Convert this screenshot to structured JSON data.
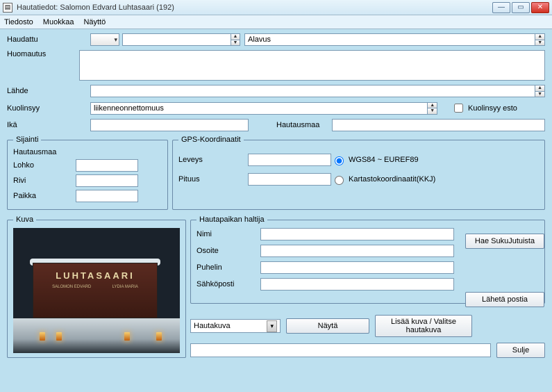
{
  "window": {
    "title": "Hautatiedot: Salomon Edvard Luhtasaari (192)"
  },
  "menu": {
    "file": "Tiedosto",
    "edit": "Muokkaa",
    "view": "Näyttö"
  },
  "fields": {
    "haudattu_label": "Haudattu",
    "haudattu_combo": "",
    "haudattu_spin": "",
    "haudattu_big": "Alavus",
    "huomautus_label": "Huomautus",
    "huomautus_value": "",
    "lahde_label": "Lähde",
    "lahde_value": "",
    "kuolinsyy_label": "Kuolinsyy",
    "kuolinsyy_value": "liikenneonnettomuus",
    "kuolinsyy_esto_label": "Kuolinsyy esto",
    "ika_label": "Ikä",
    "ika_value": "",
    "hautausmaa_label": "Hautausmaa",
    "hautausmaa_value": ""
  },
  "sijainti": {
    "legend": "Sijainti",
    "hautausmaa_legend": "Hautausmaa",
    "lohko_label": "Lohko",
    "lohko_value": "",
    "rivi_label": "Rivi",
    "rivi_value": "",
    "paikka_label": "Paikka",
    "paikka_value": ""
  },
  "gps": {
    "legend": "GPS-Koordinaatit",
    "leveys_label": "Leveys",
    "leveys_value": "",
    "pituus_label": "Pituus",
    "pituus_value": "",
    "wgs_label": "WGS84 ~ EUREF89",
    "kkj_label": "Kartastokoordinaatit(KKJ)"
  },
  "kuva": {
    "legend": "Kuva",
    "stone_name": "LUHTASAARI",
    "stone_sub_left": "SALOMON EDVARD",
    "stone_sub_right": "LYDIA MARIA"
  },
  "haltija": {
    "legend": "Hautapaikan haltija",
    "nimi_label": "Nimi",
    "nimi_value": "",
    "osoite_label": "Osoite",
    "osoite_value": "",
    "puhelin_label": "Puhelin",
    "puhelin_value": "",
    "sahkoposti_label": "Sähköposti",
    "sahkoposti_value": "",
    "hae_btn": "Hae SukuJutuista",
    "laheta_btn": "Lähetä postia"
  },
  "bottom": {
    "combo_label": "Hautakuva",
    "nayta_btn": "Näytä",
    "lisaa_btn": "Lisää kuva / Valitse hautakuva",
    "status_value": "",
    "sulje_btn": "Sulje"
  }
}
